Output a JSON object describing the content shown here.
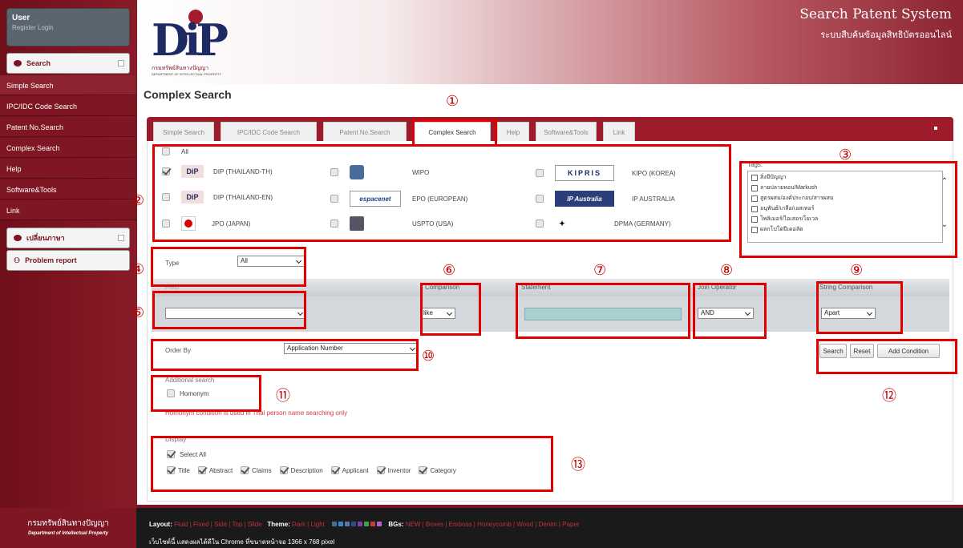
{
  "sidebar": {
    "user_title": "User",
    "user_links": "Register  Login",
    "search_panel": "Search",
    "items": [
      {
        "label": "Simple Search"
      },
      {
        "label": "IPC/IDC Code Search"
      },
      {
        "label": "Patent No.Search"
      },
      {
        "label": "Complex Search"
      },
      {
        "label": "Help"
      },
      {
        "label": "Software&Tools"
      },
      {
        "label": "Link"
      }
    ],
    "lang_panel": "เปลี่ยนภาษา",
    "problem_report": "Problem report"
  },
  "header": {
    "logo_text": "กรมทรัพย์สินทางปัญญา",
    "logo_subtext": "DEPARTMENT OF INTELLECTUAL PROPERTY",
    "system_title": "Search Patent System",
    "system_subtitle": "ระบบสืบค้นข้อมูลสิทธิบัตรออนไลน์"
  },
  "page_title": "Complex Search",
  "tabs": [
    {
      "label": "Simple Search"
    },
    {
      "label": "IPC/IDC Code Search"
    },
    {
      "label": "Patent No.Search"
    },
    {
      "label": "Complex Search"
    },
    {
      "label": "Help"
    },
    {
      "label": "Software&Tools"
    },
    {
      "label": "Link"
    }
  ],
  "databases": {
    "all_label": "All",
    "items": [
      {
        "name": "DIP (THAILAND-TH)",
        "logo": "DIP",
        "checked": true
      },
      {
        "name": "WIPO",
        "logo": "wipo-emblem",
        "checked": false
      },
      {
        "name": "KIPO (KOREA)",
        "logo": "KIPRIS",
        "checked": false
      },
      {
        "name": "DIP (THAILAND-EN)",
        "logo": "DIP",
        "checked": false
      },
      {
        "name": "EPO (EUROPEAN)",
        "logo": "espacenet",
        "checked": false
      },
      {
        "name": "IP AUSTRALIA",
        "logo": "IP Australia",
        "checked": false
      },
      {
        "name": "JPO (JAPAN)",
        "logo": "japan-flag",
        "checked": false
      },
      {
        "name": "USPTO (USA)",
        "logo": "uspto-seal",
        "checked": false
      },
      {
        "name": "DPMA (GERMANY)",
        "logo": "dpma-eagle",
        "checked": false
      }
    ]
  },
  "tags": {
    "label": "Tags:",
    "items": [
      {
        "label": "สิ่งมีปัญญา"
      },
      {
        "label": "ลายปลายหอบ/Markush"
      },
      {
        "label": "สูตรผสม/องค์ประกอบ/สารผสม"
      },
      {
        "label": "อนุพันธ์/เกลือ/เอสเทอร์"
      },
      {
        "label": "โพลิเมอร์/ไอเสอร/โยเวล"
      },
      {
        "label": "ผลกโปโตปีเดอลัด"
      }
    ]
  },
  "type": {
    "label": "Type",
    "value": "All"
  },
  "condition_headers": {
    "field": "Field",
    "comparison": "Comparison",
    "statement": "Statement",
    "join_operator": "Join Operator",
    "string_comparison": "String Comparison"
  },
  "condition_row": {
    "field": "",
    "comparison": "like",
    "statement": "",
    "join_operator": "AND",
    "string_comparison": "Apart"
  },
  "order_by": {
    "label": "Order By",
    "value": "Application Number"
  },
  "buttons": {
    "search": "Search",
    "reset": "Reset",
    "add_condition": "Add Condition"
  },
  "additional_search": {
    "label": "Additional search",
    "homonym": "Homonym",
    "note": "Homonym condition is used in Thai person name searching only"
  },
  "display": {
    "label": "Display",
    "select_all": "Select All",
    "fields": [
      {
        "label": "Title"
      },
      {
        "label": "Abstract"
      },
      {
        "label": "Claims"
      },
      {
        "label": "Description"
      },
      {
        "label": "Applicant"
      },
      {
        "label": "Inventor"
      },
      {
        "label": "Category"
      }
    ]
  },
  "annotations": [
    "①",
    "②",
    "③",
    "④",
    "⑤",
    "⑥",
    "⑦",
    "⑧",
    "⑨",
    "⑩",
    "⑪",
    "⑫",
    "⑬"
  ],
  "footer": {
    "brand": "กรมทรัพย์สินทางปัญญา",
    "brand_en": "Department of Intellectual Property",
    "layout_label": "Layout:",
    "layout_opts": "Fluid | Fixed | Side | Top | Slide",
    "theme_label": "Theme:",
    "theme_opts": "Dark | Light",
    "bgs_label": "BGs:",
    "bgs_opts": "NEW | Boxes | Emboss | Honeycomb | Wood | Denim | Paper",
    "note": "เว็บไซต์นี้ แสดงผลได้ดีใน Chrome ที่ขนาดหน้าจอ 1366 x 768 pixel"
  }
}
